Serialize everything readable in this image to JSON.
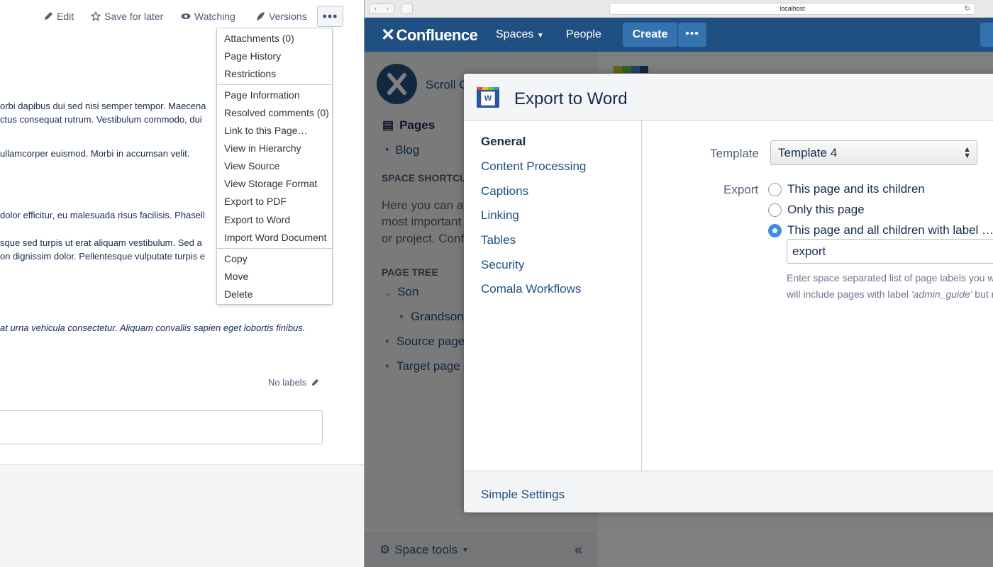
{
  "toolbar": {
    "edit": "Edit",
    "save_for_later": "Save for later",
    "watching": "Watching",
    "versions": "Versions",
    "more": "•••"
  },
  "page_menu": {
    "group1": [
      "Attachments (0)",
      "Page History",
      "Restrictions"
    ],
    "group2": [
      "Page Information",
      "Resolved comments (0)",
      "Link to this Page…",
      "View in Hierarchy",
      "View Source",
      "View Storage Format",
      "Export to PDF",
      "Export to Word",
      "Import Word Document"
    ],
    "group3": [
      "Copy",
      "Move",
      "Delete"
    ]
  },
  "page_body": {
    "lines": [
      "orbi dapibus dui sed nisi semper tempor. Maecena",
      "ctus consequat rutrum. Vestibulum commodo, dui",
      "ullamcorper euismod. Morbi in accumsan velit.",
      "dolor efficitur, eu malesuada risus facilisis. Phasell",
      "sque sed turpis ut erat aliquam vestibulum. Sed a",
      "on dignissim dolor. Pellentesque vulputate turpis e",
      "at urna vehicula consectetur. Aliquam convallis sapien eget lobortis finibus."
    ],
    "labels": "No labels"
  },
  "browser": {
    "url": "localhost"
  },
  "confluence": {
    "logo": "Confluence",
    "nav": {
      "spaces": "Spaces",
      "people": "People",
      "create": "Create",
      "more": "•••"
    },
    "sidebar": {
      "space_name": "Scroll C",
      "pages": "Pages",
      "blog": "Blog",
      "shortcuts_heading": "SPACE SHORTCU",
      "shortcuts_text": [
        "Here you can ad",
        "most important",
        "or project. Conf"
      ],
      "page_tree_heading": "PAGE TREE",
      "tree": [
        "Son",
        "Grandson",
        "Source page",
        "Target page"
      ],
      "space_tools": "Space tools",
      "collapse": "«"
    }
  },
  "dialog": {
    "title": "Export to Word",
    "nav": [
      "General",
      "Content Processing",
      "Captions",
      "Linking",
      "Tables",
      "Security",
      "Comala Workflows"
    ],
    "template_label": "Template",
    "template_value": "Template 4",
    "export_label": "Export",
    "export_options": [
      "This page and its children",
      "Only this page",
      "This page and all children with label …"
    ],
    "export_selected_index": 2,
    "label_value": "export",
    "help_lines": [
      "Enter space separated list of page labels you w",
      "will include pages with label 'admin_guide' but r"
    ],
    "footer_link": "Simple Settings"
  },
  "colors": {
    "confluence_header": "#205081",
    "link": "#205081",
    "radio_checked": "#3b8beb"
  }
}
